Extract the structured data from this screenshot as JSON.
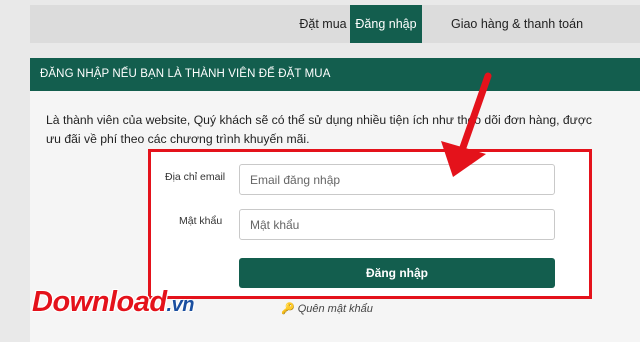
{
  "tabs": {
    "dat_mua": "Đặt mua",
    "dang_nhap": "Đăng nhập",
    "giao_hang": "Giao hàng & thanh toán"
  },
  "section": {
    "heading": "ĐĂNG NHẬP NẾU BẠN LÀ THÀNH VIÊN ĐỂ ĐẶT MUA",
    "intro": "Là thành viên của website, Quý khách sẽ có thể sử dụng nhiều tiện ích như theo dõi đơn hàng, được ưu đãi về phí theo các chương trình khuyến mãi."
  },
  "form": {
    "email_label": "Địa chỉ email",
    "email_placeholder": "Email đăng nhập",
    "email_value": "",
    "password_label": "Mật khẩu",
    "password_placeholder": "Mật khẩu",
    "password_value": "",
    "submit_label": "Đăng nhập",
    "forgot_label": "Quên mật khẩu"
  },
  "icons": {
    "forgot": "key-icon",
    "annotation": "red-arrow-icon"
  },
  "watermark": {
    "main": "Download",
    "suffix": ".vn"
  },
  "colors": {
    "brand_green": "#135e4e",
    "highlight_red": "#e4121b"
  }
}
